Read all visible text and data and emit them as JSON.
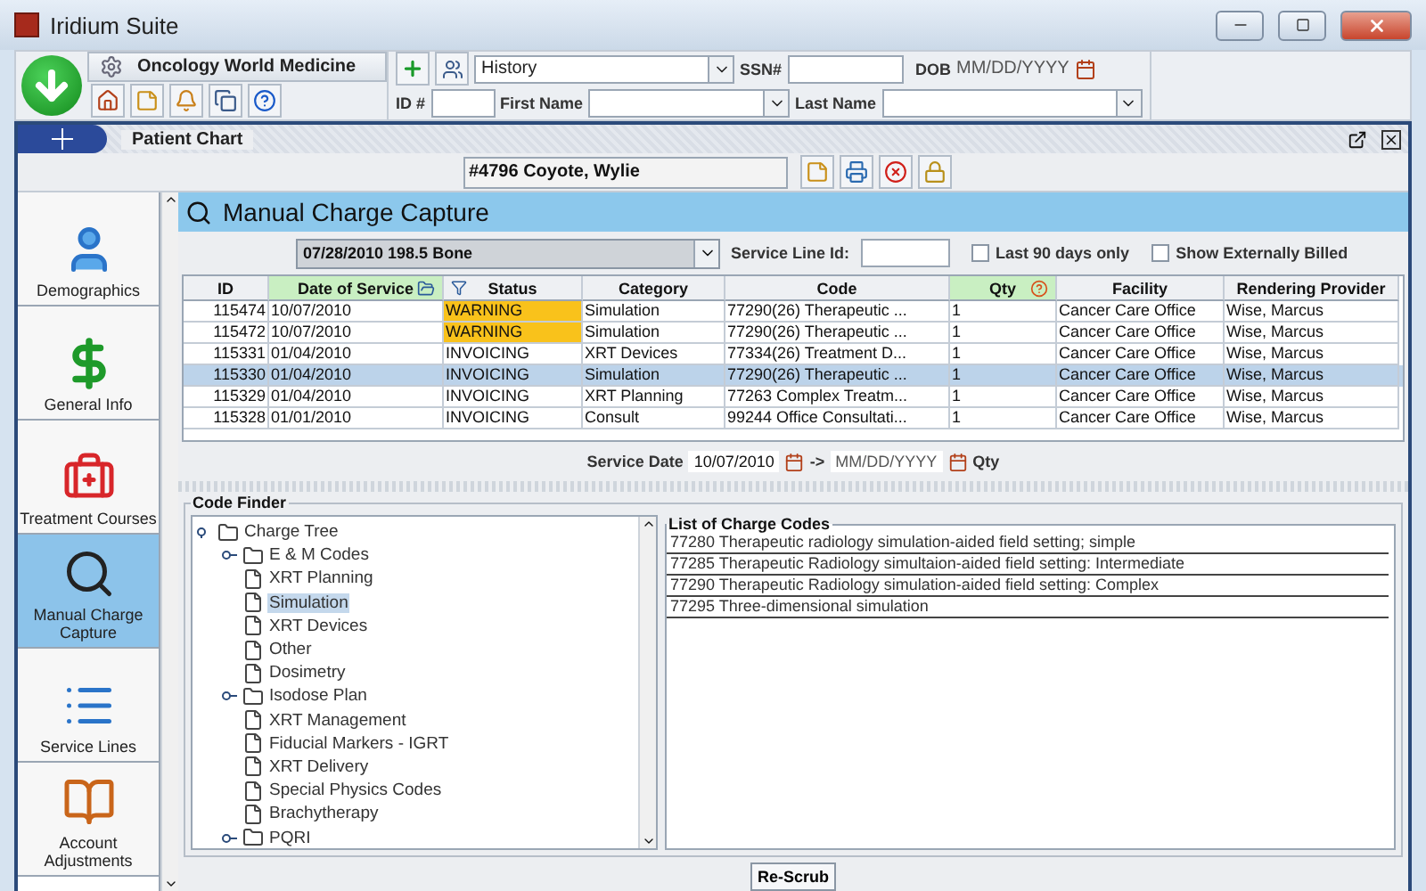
{
  "window": {
    "title": "Iridium Suite"
  },
  "toolbar": {
    "practice_button": "Oncology World Medicine",
    "history_select": "History",
    "ssn_label": "SSN#",
    "dob_label": "DOB",
    "dob_placeholder": "MM/DD/YYYY",
    "id_label": "ID #",
    "first_name_label": "First Name",
    "last_name_label": "Last Name"
  },
  "chart": {
    "title": "Patient Chart",
    "patient": "#4796 Coyote, Wylie"
  },
  "sidebar": {
    "items": [
      {
        "label": "Demographics",
        "kind": "person",
        "selected": false
      },
      {
        "label": "General Info",
        "kind": "dollar",
        "selected": false
      },
      {
        "label": "Treatment Courses",
        "kind": "kit",
        "selected": false
      },
      {
        "label": "Manual Charge Capture",
        "kind": "cpt",
        "selected": true
      },
      {
        "label": "Service Lines",
        "kind": "lines",
        "selected": false
      },
      {
        "label": "Account Adjustments",
        "kind": "book",
        "selected": false
      }
    ]
  },
  "panel": {
    "title": "Manual Charge Capture",
    "course_select": "07/28/2010 198.5 Bone",
    "service_line_label": "Service Line Id:",
    "filters": [
      {
        "label": "Last 90 days only",
        "checked": false
      },
      {
        "label": "Show Externally Billed",
        "checked": false
      }
    ]
  },
  "table": {
    "columns": [
      {
        "label": "ID",
        "highlighted": false
      },
      {
        "label": "Date of Service",
        "highlighted": true
      },
      {
        "label": "Status",
        "highlighted": false
      },
      {
        "label": "Category",
        "highlighted": false
      },
      {
        "label": "Code",
        "highlighted": false
      },
      {
        "label": "Qty",
        "highlighted": true
      },
      {
        "label": "Facility",
        "highlighted": false
      },
      {
        "label": "Rendering Provider",
        "highlighted": false
      }
    ],
    "rows": [
      {
        "cells": [
          "115474",
          "10/07/2010",
          "WARNING",
          "Simulation",
          "77290(26) Therapeutic ...",
          "1",
          "Cancer Care Office",
          "Wise, Marcus"
        ],
        "warning": true,
        "selected": false
      },
      {
        "cells": [
          "115472",
          "10/07/2010",
          "WARNING",
          "Simulation",
          "77290(26) Therapeutic ...",
          "1",
          "Cancer Care Office",
          "Wise, Marcus"
        ],
        "warning": true,
        "selected": false
      },
      {
        "cells": [
          "115331",
          "01/04/2010",
          "INVOICING",
          "XRT Devices",
          "77334(26) Treatment D...",
          "1",
          "Cancer Care Office",
          "Wise, Marcus"
        ],
        "warning": false,
        "selected": false
      },
      {
        "cells": [
          "115330",
          "01/04/2010",
          "INVOICING",
          "Simulation",
          "77290(26) Therapeutic ...",
          "1",
          "Cancer Care Office",
          "Wise, Marcus"
        ],
        "warning": false,
        "selected": true
      },
      {
        "cells": [
          "115329",
          "01/04/2010",
          "INVOICING",
          "XRT Planning",
          "77263 Complex Treatm...",
          "1",
          "Cancer Care Office",
          "Wise, Marcus"
        ],
        "warning": false,
        "selected": false
      },
      {
        "cells": [
          "115328",
          "01/01/2010",
          "INVOICING",
          "Consult",
          "99244 Office Consultati...",
          "1",
          "Cancer Care Office",
          "Wise, Marcus"
        ],
        "warning": false,
        "selected": false
      }
    ]
  },
  "service_date": {
    "label": "Service Date",
    "from": "10/07/2010",
    "arrow": "->",
    "to_placeholder": "MM/DD/YYYY",
    "qty_label": "Qty"
  },
  "code_finder": {
    "title": "Code Finder",
    "tree": [
      {
        "label": "Charge Tree",
        "kind": "folder",
        "expanded": true,
        "selected": false,
        "children": [
          {
            "label": "E & M Codes",
            "kind": "folder",
            "expanded": false,
            "selected": false
          },
          {
            "label": "XRT Planning",
            "kind": "file",
            "selected": false
          },
          {
            "label": "Simulation",
            "kind": "file",
            "selected": true
          },
          {
            "label": "XRT Devices",
            "kind": "file",
            "selected": false
          },
          {
            "label": "Other",
            "kind": "file",
            "selected": false
          },
          {
            "label": "Dosimetry",
            "kind": "file",
            "selected": false
          },
          {
            "label": "Isodose Plan",
            "kind": "folder",
            "expanded": false,
            "selected": false
          },
          {
            "label": "XRT Management",
            "kind": "file",
            "selected": false
          },
          {
            "label": "Fiducial Markers - IGRT",
            "kind": "file",
            "selected": false
          },
          {
            "label": "XRT Delivery",
            "kind": "file",
            "selected": false
          },
          {
            "label": "Special Physics Codes",
            "kind": "file",
            "selected": false
          },
          {
            "label": "Brachytherapy",
            "kind": "file",
            "selected": false
          },
          {
            "label": "PQRI",
            "kind": "folder",
            "expanded": false,
            "selected": false
          }
        ]
      }
    ],
    "list_title": "List of Charge Codes",
    "codes": [
      "77280 Therapeutic radiology simulation-aided field setting; simple",
      "77285 Therapeutic Radiology simultaion-aided field setting: Intermediate",
      "77290 Therapeutic Radiology simulation-aided field setting: Complex",
      "77295 Three-dimensional simulation"
    ]
  },
  "rescrub_button": "Re-Scrub"
}
